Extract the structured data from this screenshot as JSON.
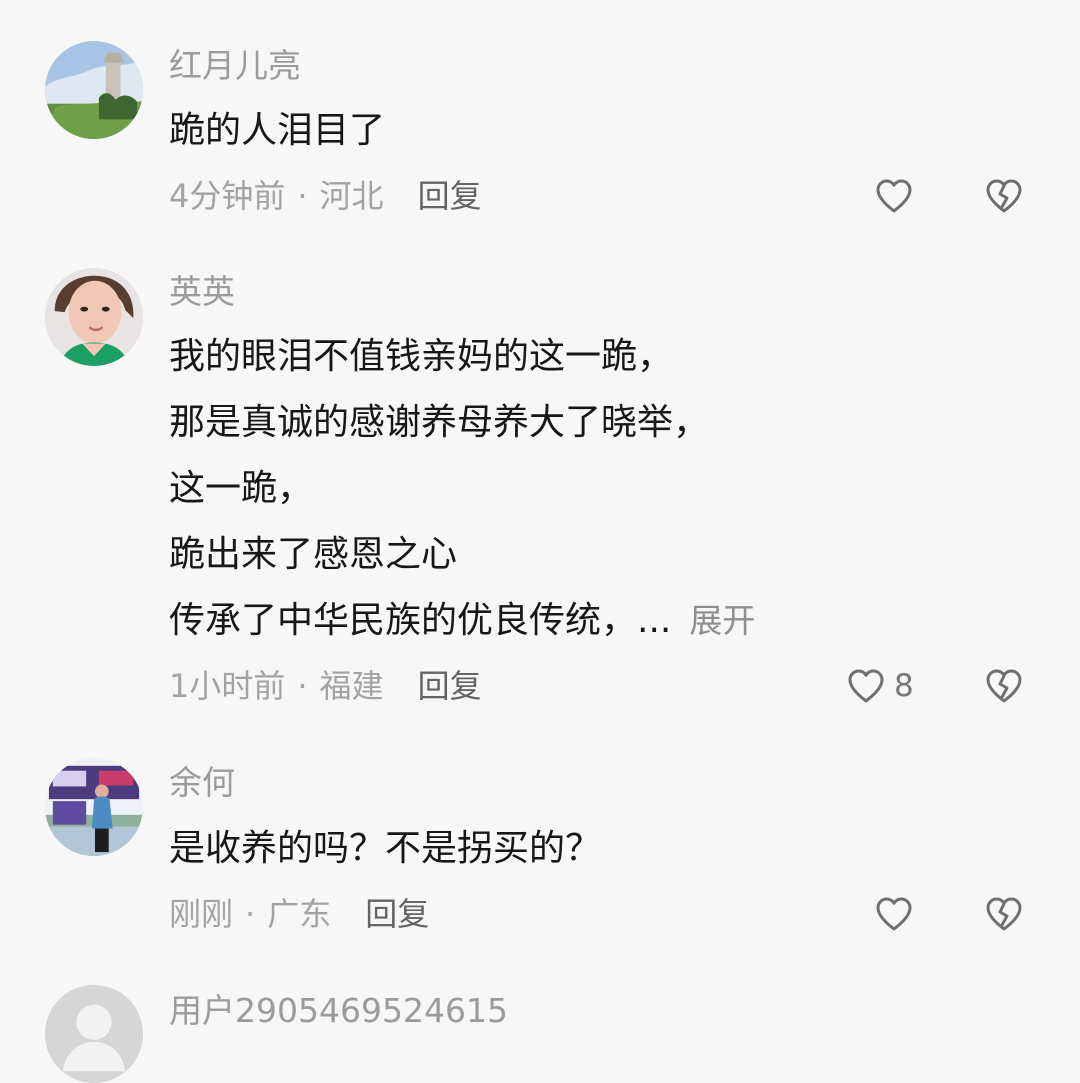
{
  "comments": [
    {
      "username": "红月儿亮",
      "lines": [
        "跪的人泪目了"
      ],
      "time": "4分钟前",
      "location": "河北",
      "reply_label": "回复",
      "like_count": "",
      "avatar_icon": "landscape-avatar"
    },
    {
      "username": "英英",
      "lines": [
        "我的眼泪不值钱亲妈的这一跪，",
        "那是真诚的感谢养母养大了晓举，",
        "这一跪，",
        "跪出来了感恩之心",
        "传承了中华民族的优良传统，..."
      ],
      "expand_label": "展开",
      "time": "1小时前",
      "location": "福建",
      "reply_label": "回复",
      "like_count": "8",
      "avatar_icon": "portrait-avatar"
    },
    {
      "username": "余何",
      "lines": [
        "是收养的吗？不是拐买的？"
      ],
      "time": "刚刚",
      "location": "广东",
      "reply_label": "回复",
      "like_count": "",
      "avatar_icon": "event-photo-avatar"
    },
    {
      "username": "用户2905469524615",
      "avatar_icon": "default-avatar"
    }
  ],
  "separator": "·",
  "colors": {
    "background": "#f7f7f7",
    "username": "#9b9b9b",
    "text": "#171717",
    "meta": "#a3a3a3",
    "reply": "#646464",
    "icon": "#6f6f6f"
  }
}
